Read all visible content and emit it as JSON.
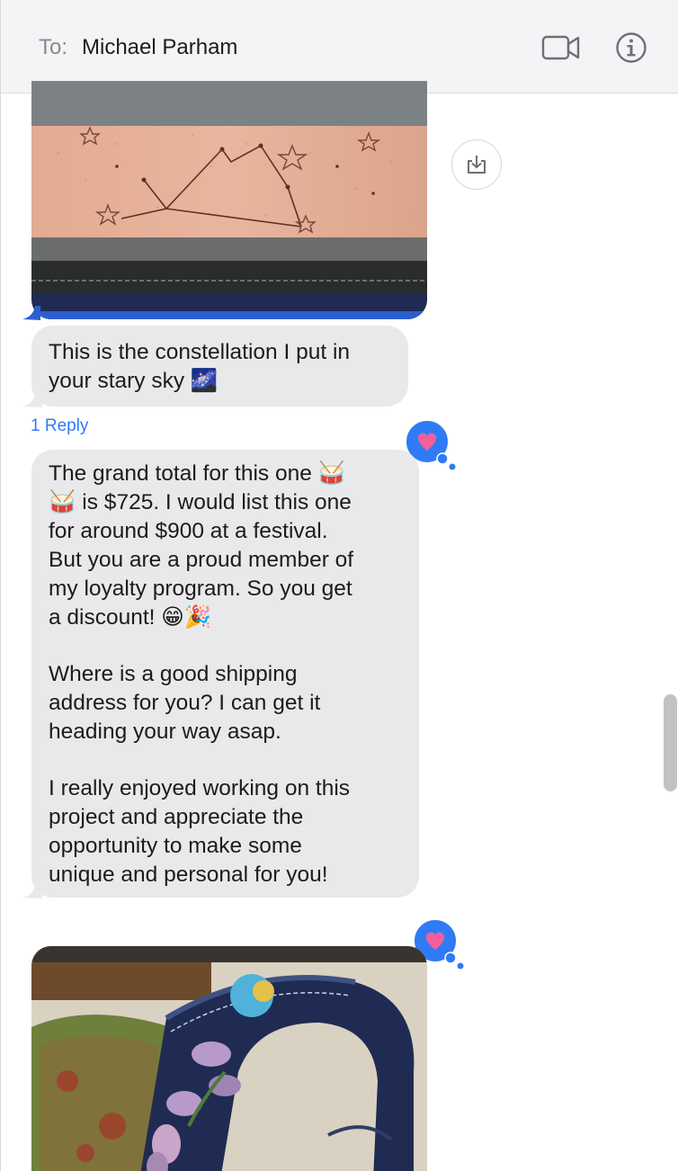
{
  "header": {
    "to_label": "To:",
    "recipient": "Michael Parham",
    "video_icon": "video-camera-icon",
    "info_icon": "info-icon"
  },
  "messages": {
    "image1_alt": "leather strap with constellation design",
    "save_icon": "save-download-icon",
    "bubble1": {
      "lines": [
        "This is the constellation I put in",
        "your stary sky 🌌"
      ]
    },
    "reply_link": "1 Reply",
    "bubble2": {
      "lines": [
        "The grand total for this one 🥁",
        "🥁 is $725.  I would list this one",
        "for around $900 at a festival.",
        "But you are a proud member of",
        "my loyalty program.  So you get",
        "a discount!  😁🎉",
        "",
        "Where is a good shipping",
        "address for you? I can get it",
        "heading your way asap.",
        "",
        "I really enjoyed working on this",
        "project and appreciate the",
        "opportunity to make some",
        "unique and personal for you!"
      ]
    },
    "tapback_icon": "heart-icon",
    "image2_alt": "tooled leather guitar straps with flowers"
  },
  "colors": {
    "bubble_gray": "#e9e9eb",
    "accent_blue": "#2f7bf5",
    "heart_pink": "#f0609a"
  }
}
